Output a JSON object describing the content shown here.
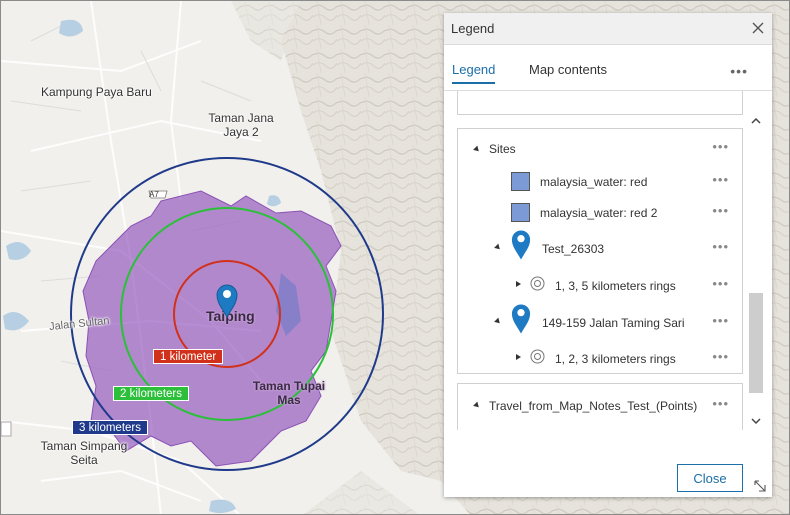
{
  "map": {
    "place_labels": [
      "Kampung Paya Baru",
      "Taman Jana Jaya 2",
      "Taman Tupai Mas",
      "Taman Simpang Seita"
    ],
    "city_label": "Taiping",
    "road_label": "Jalan Sultan",
    "route_shield": "A7",
    "rings": [
      {
        "label": "1 kilometer",
        "color": "#d1311a"
      },
      {
        "label": "2 kilometers",
        "color": "#2bbf3a"
      },
      {
        "label": "3 kilometers",
        "color": "#1f3a8a"
      }
    ],
    "area_color": "#9a5fc0"
  },
  "legend": {
    "title": "Legend",
    "tabs": [
      {
        "label": "Legend",
        "active": true
      },
      {
        "label": "Map contents",
        "active": false
      }
    ],
    "more": "•••",
    "items": [
      {
        "label": "Sites",
        "more": "•••"
      },
      {
        "label": "malaysia_water: red",
        "more": "•••"
      },
      {
        "label": "malaysia_water: red 2",
        "more": "•••"
      },
      {
        "label": "Test_26303",
        "more": "•••"
      },
      {
        "label": "1, 3, 5 kilometers rings",
        "more": "•••"
      },
      {
        "label": "149-159 Jalan Taming Sari",
        "more": "•••"
      },
      {
        "label": "1, 2, 3 kilometers rings",
        "more": "•••"
      },
      {
        "label": "Travel_from_Map_Notes_Test_(Points)",
        "more": "•••"
      }
    ],
    "close_button": "Close",
    "accent": "#1b6ea8",
    "swatch_color": "#7b9ad6"
  }
}
